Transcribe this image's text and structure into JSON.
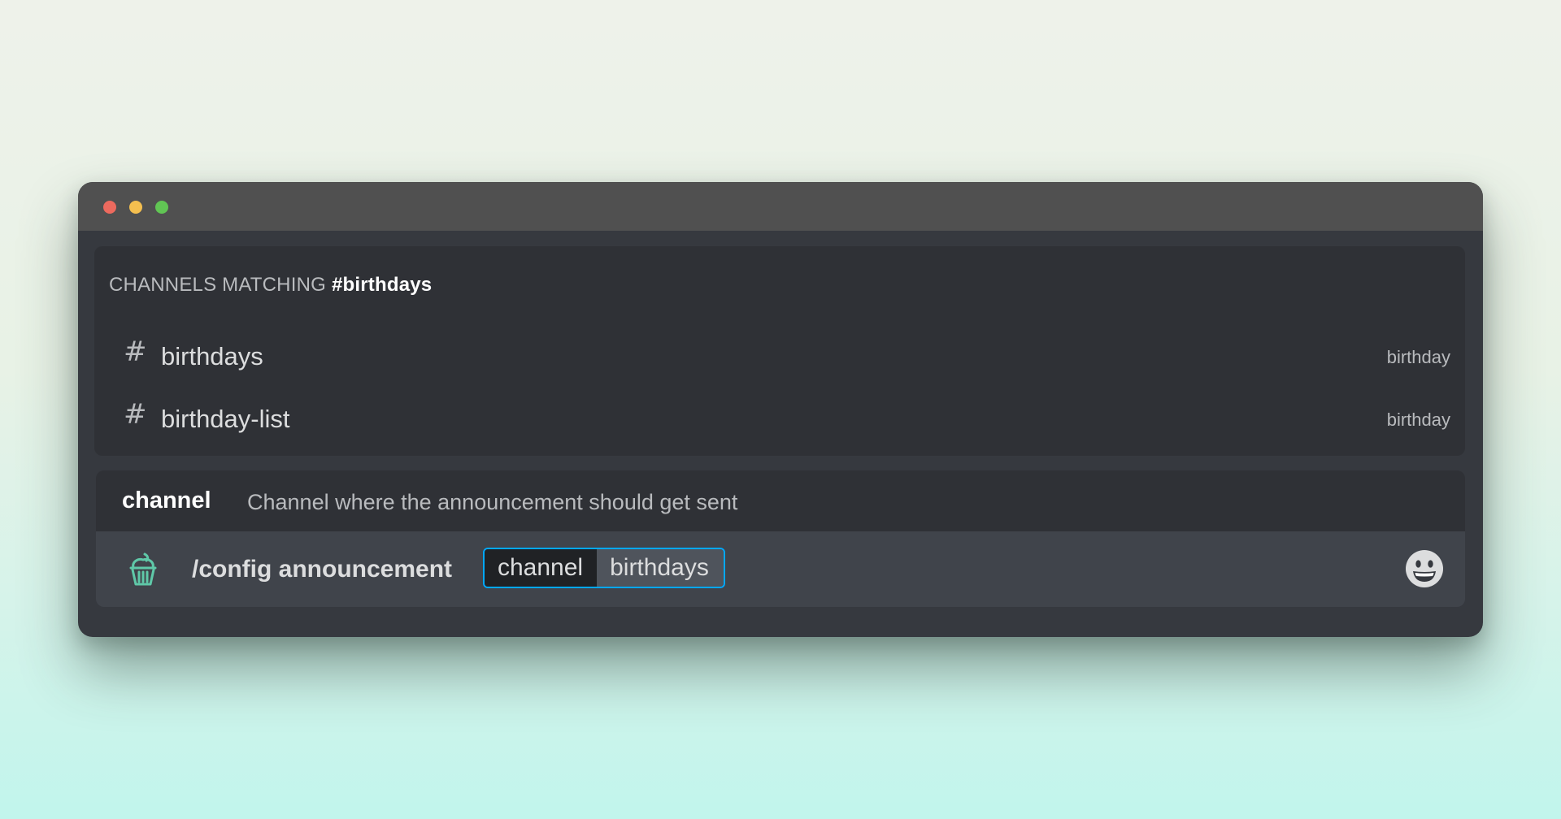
{
  "window": {
    "controls": [
      "close",
      "minimize",
      "maximize"
    ]
  },
  "autocomplete": {
    "header_prefix": "CHANNELS MATCHING",
    "header_query": "#birthdays",
    "items": [
      {
        "icon": "hash-icon",
        "name": "birthdays",
        "category": "birthday"
      },
      {
        "icon": "hash-icon",
        "name": "birthday-list",
        "category": "birthday"
      }
    ]
  },
  "option": {
    "name": "channel",
    "description": "Channel where the announcement should get sent"
  },
  "input": {
    "app_icon": "cupcake-icon",
    "command": "/config announcement",
    "param_name": "channel",
    "param_value": "birthdays",
    "emoji_icon": "smiley-icon"
  },
  "colors": {
    "window_bg": "#36393f",
    "panel_bg": "#2f3136",
    "input_bg": "#40444b",
    "accent_blue": "#00a8fc",
    "icon_teal": "#5fc8a8"
  }
}
